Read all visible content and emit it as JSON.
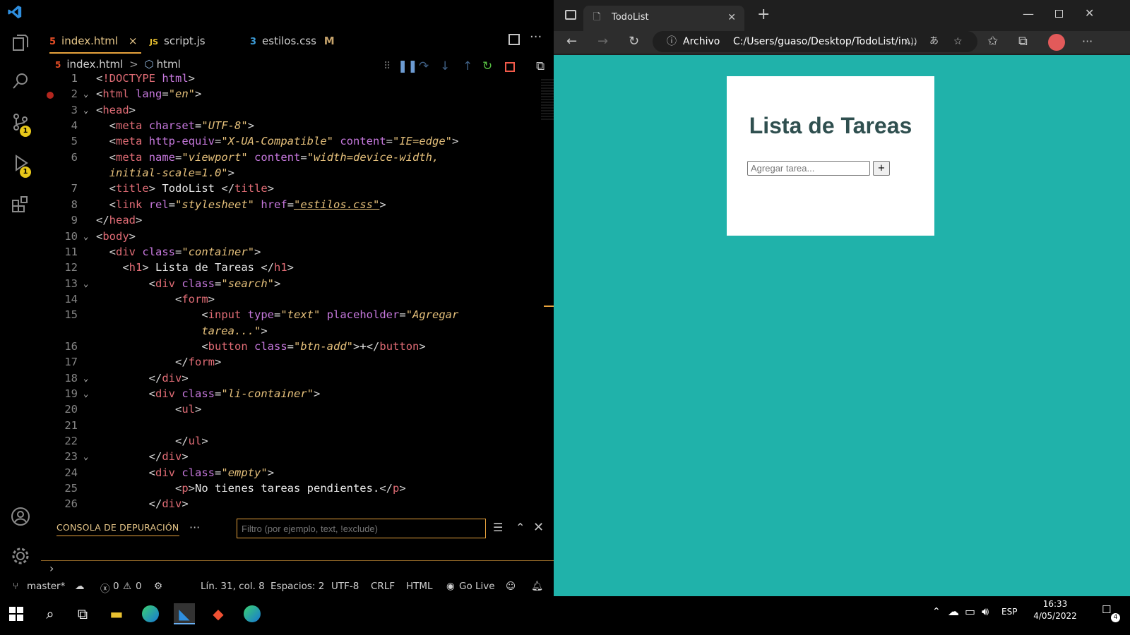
{
  "vscode": {
    "tabs": [
      {
        "icon": "5",
        "label": "index.html",
        "close": "×"
      },
      {
        "icon": "JS",
        "label": "script.js"
      },
      {
        "icon": "3",
        "label": "estilos.css",
        "mod": "M"
      }
    ],
    "breadcrumb": {
      "file": "index.html",
      "sep": ">",
      "node": "html"
    },
    "code_lines": [
      {
        "n": "1"
      },
      {
        "n": "2"
      },
      {
        "n": "3"
      },
      {
        "n": "4"
      },
      {
        "n": "5"
      },
      {
        "n": "6"
      },
      {
        "n": ""
      },
      {
        "n": "7"
      },
      {
        "n": "8"
      },
      {
        "n": "9"
      },
      {
        "n": "10"
      },
      {
        "n": "11"
      },
      {
        "n": "12"
      },
      {
        "n": "13"
      },
      {
        "n": "14"
      },
      {
        "n": "15"
      },
      {
        "n": ""
      },
      {
        "n": "16"
      },
      {
        "n": "17"
      },
      {
        "n": "18"
      },
      {
        "n": "19"
      },
      {
        "n": "20"
      },
      {
        "n": "21"
      },
      {
        "n": "22"
      },
      {
        "n": "23"
      },
      {
        "n": "24"
      },
      {
        "n": "25"
      },
      {
        "n": "26"
      }
    ],
    "panel": {
      "tab": "CONSOLA DE DEPURACIÓN",
      "filter_placeholder": "Filtro (por ejemplo, text, !exclude)",
      "more": "···"
    },
    "statusbar": {
      "branch": "master*",
      "errors": "0",
      "warnings": "0",
      "position": "Lín. 31, col. 8",
      "spaces": "Espacios: 2",
      "encoding": "UTF-8",
      "eol": "CRLF",
      "language": "HTML",
      "golive": "Go Live"
    },
    "badges": [
      "1",
      "1"
    ]
  },
  "browser": {
    "tab_title": "TodoList",
    "address_label": "Archivo",
    "address": "C:/Users/guaso/Desktop/TodoList/in...",
    "page": {
      "heading": "Lista de Tareas",
      "input_placeholder": "Agregar tarea...",
      "add_button": "+"
    }
  },
  "taskbar": {
    "lang": "ESP",
    "time": "16:33",
    "date": "4/05/2022",
    "notif_count": "4"
  },
  "colors": {
    "page_bg": "#20b2aa",
    "accent": "#e8a33d",
    "heading": "#2f4f4f"
  }
}
